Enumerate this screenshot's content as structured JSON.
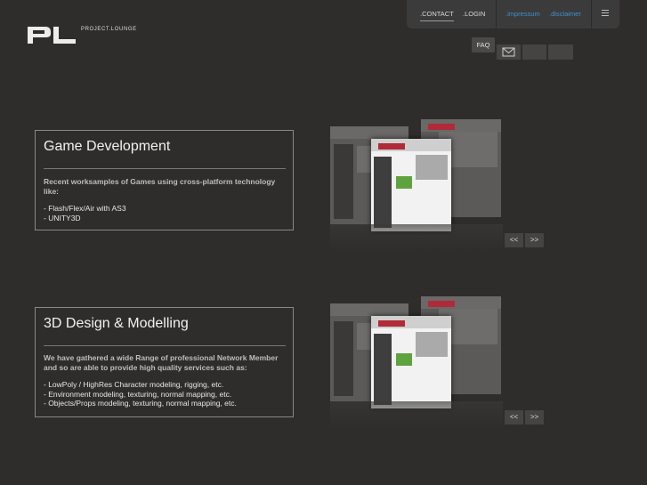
{
  "header": {
    "logo_text": "PROJECT.LOUNGE",
    "nav": {
      "contact": ".CONTACT",
      "login": ".LOGIN",
      "impressum": ".impressum",
      "disclaimer": ".disclaimer"
    },
    "faq": "FAQ",
    "menu_icon": "hamburger-icon",
    "mail_icon": "mail-icon"
  },
  "sections": [
    {
      "title": "Game Development",
      "lead": "Recent worksamples of Games using cross-platform technology like:",
      "items": [
        "- Flash/Flex/Air with AS3",
        "- UNITY3D"
      ],
      "prev": "<<",
      "next": ">>"
    },
    {
      "title": "3D Design & Modelling",
      "lead": "We have gathered a wide Range of professional Network Member and so are able to provide high quality services such as:",
      "items": [
        "- LowPoly / HighRes Character modeling, rigging, etc.",
        "- Environment modeling, texturing, normal mapping, etc.",
        "- Objects/Props modeling, texturing, normal mapping, etc."
      ],
      "prev": "<<",
      "next": ">>"
    }
  ],
  "colors": {
    "background": "#2f2d2c",
    "accent_link": "#3f8fd0",
    "badge": "#b02a38"
  }
}
